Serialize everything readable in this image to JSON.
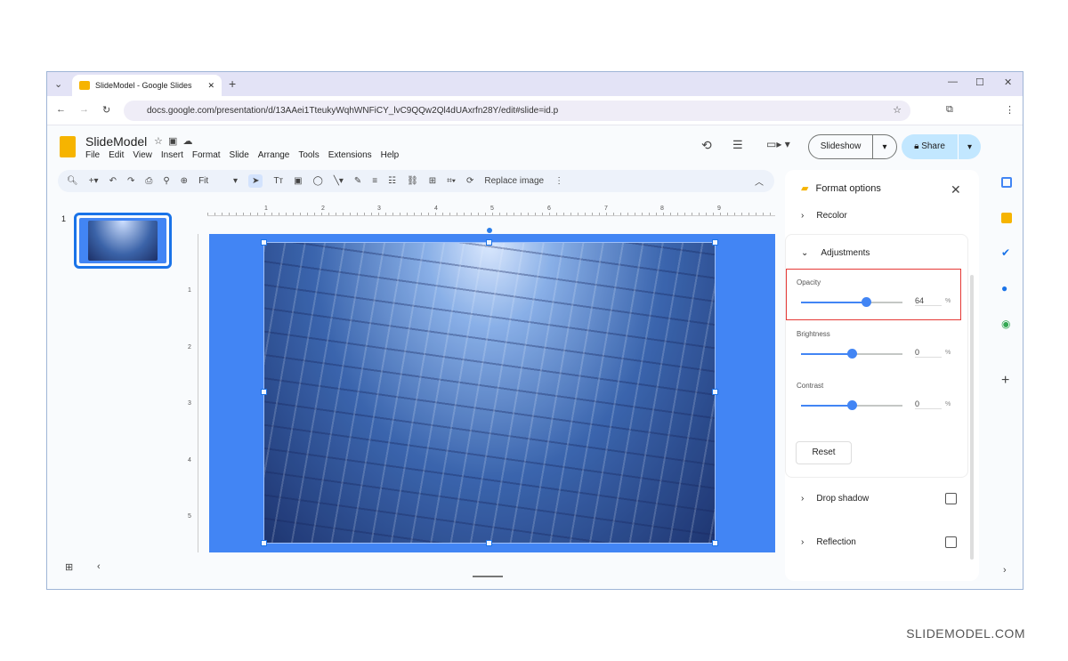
{
  "browser": {
    "tab_title": "SlideModel - Google Slides",
    "url": "docs.google.com/presentation/d/13AAei1TteukyWqhWNFiCY_lvC9QQw2Ql4dUAxrfn28Y/edit#slide=id.p"
  },
  "doc": {
    "title": "SlideModel",
    "menu": [
      "File",
      "Edit",
      "View",
      "Insert",
      "Format",
      "Slide",
      "Arrange",
      "Tools",
      "Extensions",
      "Help"
    ]
  },
  "toolbar": {
    "zoom": "Fit",
    "replace_image": "Replace image"
  },
  "header": {
    "slideshow": "Slideshow",
    "share": "Share"
  },
  "filmstrip": {
    "slide_number": "1"
  },
  "rulers": {
    "h": [
      "1",
      "2",
      "3",
      "4",
      "5",
      "6",
      "7",
      "8",
      "9"
    ],
    "v": [
      "1",
      "2",
      "3",
      "4",
      "5"
    ]
  },
  "format_panel": {
    "title": "Format options",
    "recolor": "Recolor",
    "adjustments": "Adjustments",
    "opacity": {
      "label": "Opacity",
      "value": "64",
      "unit": "%"
    },
    "brightness": {
      "label": "Brightness",
      "value": "0",
      "unit": "%"
    },
    "contrast": {
      "label": "Contrast",
      "value": "0",
      "unit": "%"
    },
    "reset": "Reset",
    "drop_shadow": "Drop shadow",
    "reflection": "Reflection"
  },
  "highlight_color": "#e53935",
  "watermark": "SLIDEMODEL.COM"
}
